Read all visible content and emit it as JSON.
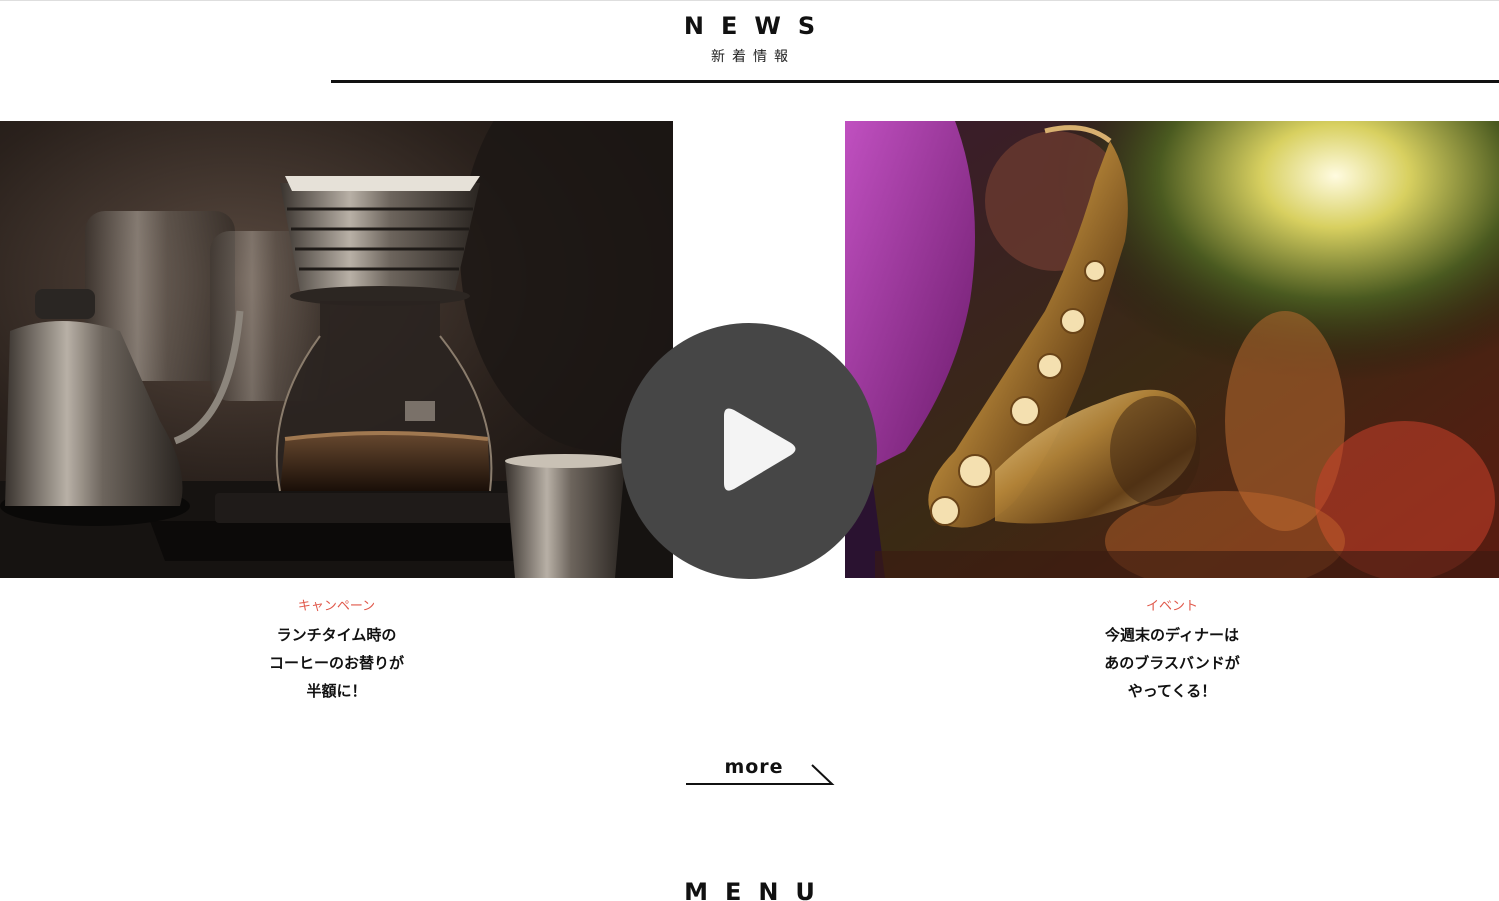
{
  "news": {
    "title": "NEWS",
    "subtitle": "新着情報"
  },
  "cards": [
    {
      "category": "キャンペーン",
      "headline_lines": [
        "ランチタイム時の",
        "コーヒーのお替りが",
        "半額に！"
      ],
      "image_icon": "coffee-pourover-photo"
    },
    {
      "category": "イベント",
      "headline_lines": [
        "今週末のディナーは",
        "あのブラスバンドが",
        "やってくる！"
      ],
      "image_icon": "saxophone-concert-photo"
    }
  ],
  "video": {
    "play_icon": "play-icon"
  },
  "more": {
    "label": "more",
    "arrow_icon": "arrow-right-icon"
  },
  "menu": {
    "title": "MENU"
  },
  "colors": {
    "category_accent": "#e0584a",
    "play_button": "#464646",
    "text": "#111111"
  }
}
